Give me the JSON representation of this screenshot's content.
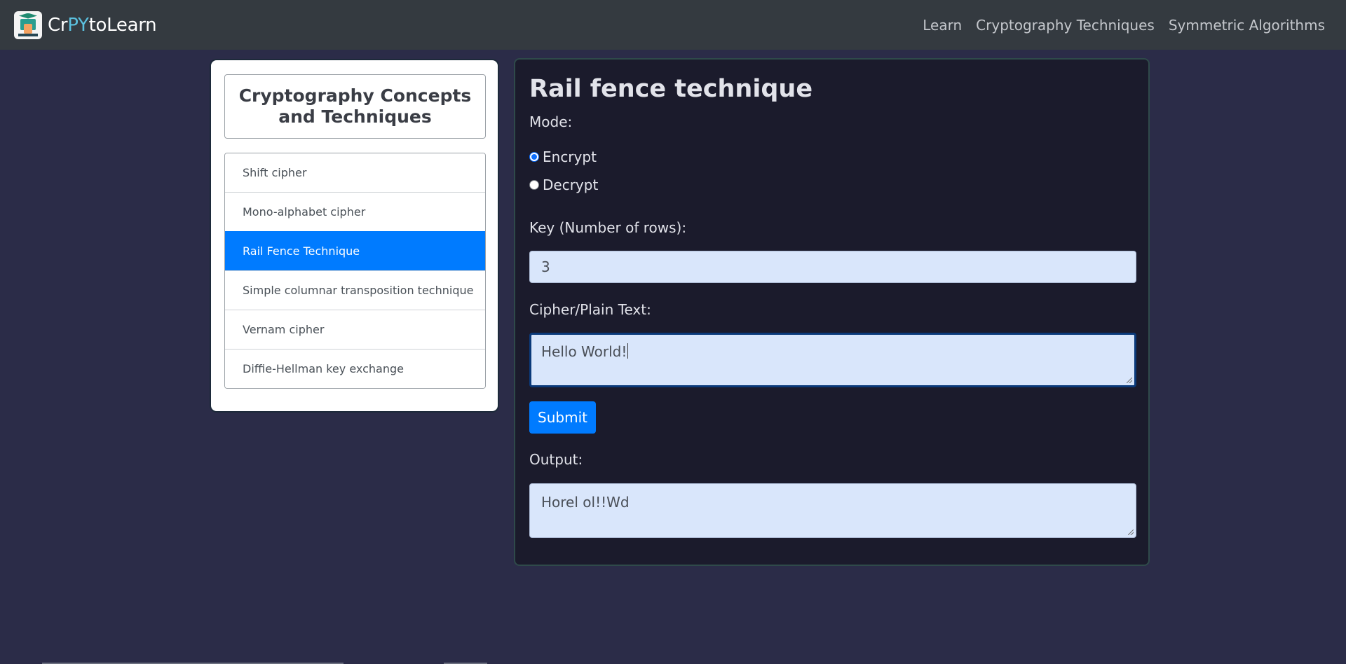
{
  "brand": {
    "prefix": "Cr",
    "highlight": "PY",
    "suffix": "toLearn"
  },
  "nav": {
    "items": [
      "Learn",
      "Cryptography Techniques",
      "Symmetric Algorithms"
    ]
  },
  "sidebar": {
    "title": "Cryptography Concepts and Techniques",
    "items": [
      {
        "label": "Shift cipher",
        "active": false
      },
      {
        "label": "Mono-alphabet cipher",
        "active": false
      },
      {
        "label": "Rail Fence Technique",
        "active": true
      },
      {
        "label": "Simple columnar transposition technique",
        "active": false
      },
      {
        "label": "Vernam cipher",
        "active": false
      },
      {
        "label": "Diffie-Hellman key exchange",
        "active": false
      }
    ]
  },
  "main": {
    "title": "Rail fence technique",
    "mode_label": "Mode:",
    "modes": [
      {
        "label": "Encrypt",
        "checked": true
      },
      {
        "label": "Decrypt",
        "checked": false
      }
    ],
    "key_label": "Key (Number of rows):",
    "key_value": "3",
    "text_label": "Cipher/Plain Text:",
    "text_value": "Hello World!",
    "submit_label": "Submit",
    "output_label": "Output:",
    "output_value": "Horel ol!!Wd"
  },
  "colors": {
    "page_bg": "#2b2c48",
    "navbar_bg": "#343a40",
    "accent": "#007bff",
    "panel_bg": "#1b1b2c",
    "field_bg": "#d9e6fb"
  },
  "icons": {
    "logo": "crypto-learning-logo-icon"
  }
}
